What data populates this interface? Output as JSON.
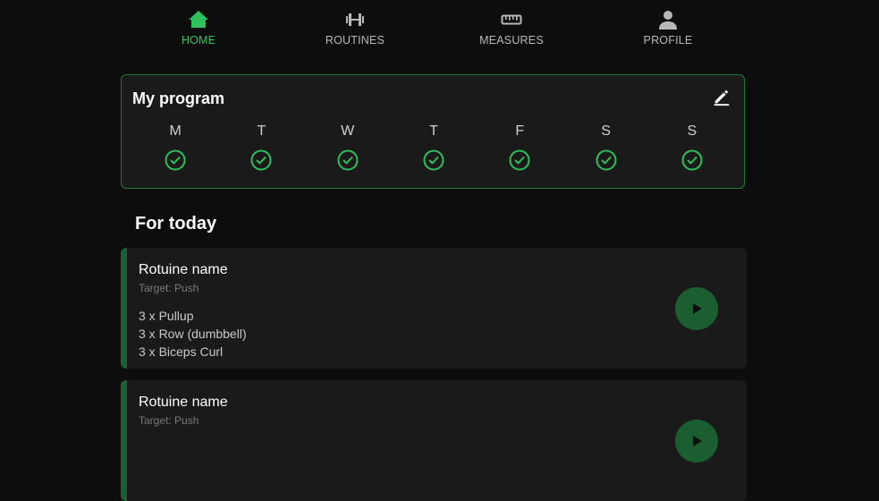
{
  "nav": {
    "items": [
      {
        "label": "HOME",
        "icon": "home-icon",
        "active": true
      },
      {
        "label": "ROUTINES",
        "icon": "dumbbell-icon",
        "active": false
      },
      {
        "label": "MEASURES",
        "icon": "ruler-icon",
        "active": false
      },
      {
        "label": "PROFILE",
        "icon": "person-icon",
        "active": false
      }
    ]
  },
  "program": {
    "title": "My program",
    "days": [
      {
        "letter": "M",
        "done": true
      },
      {
        "letter": "T",
        "done": true
      },
      {
        "letter": "W",
        "done": true
      },
      {
        "letter": "T",
        "done": true
      },
      {
        "letter": "F",
        "done": true
      },
      {
        "letter": "S",
        "done": true
      },
      {
        "letter": "S",
        "done": true
      }
    ]
  },
  "today": {
    "title": "For today",
    "routines": [
      {
        "name": "Rotuine name",
        "target": "Target: Push",
        "exercises": [
          "3 x Pullup",
          "3 x Row (dumbbell)",
          "3 x Biceps Curl"
        ]
      },
      {
        "name": "Rotuine name",
        "target": "Target: Push",
        "exercises": []
      }
    ]
  },
  "colors": {
    "accent": "#2ec05a",
    "accent_dark": "#1b5e30",
    "background": "#0d0d0d",
    "card": "#1a1a1a"
  }
}
